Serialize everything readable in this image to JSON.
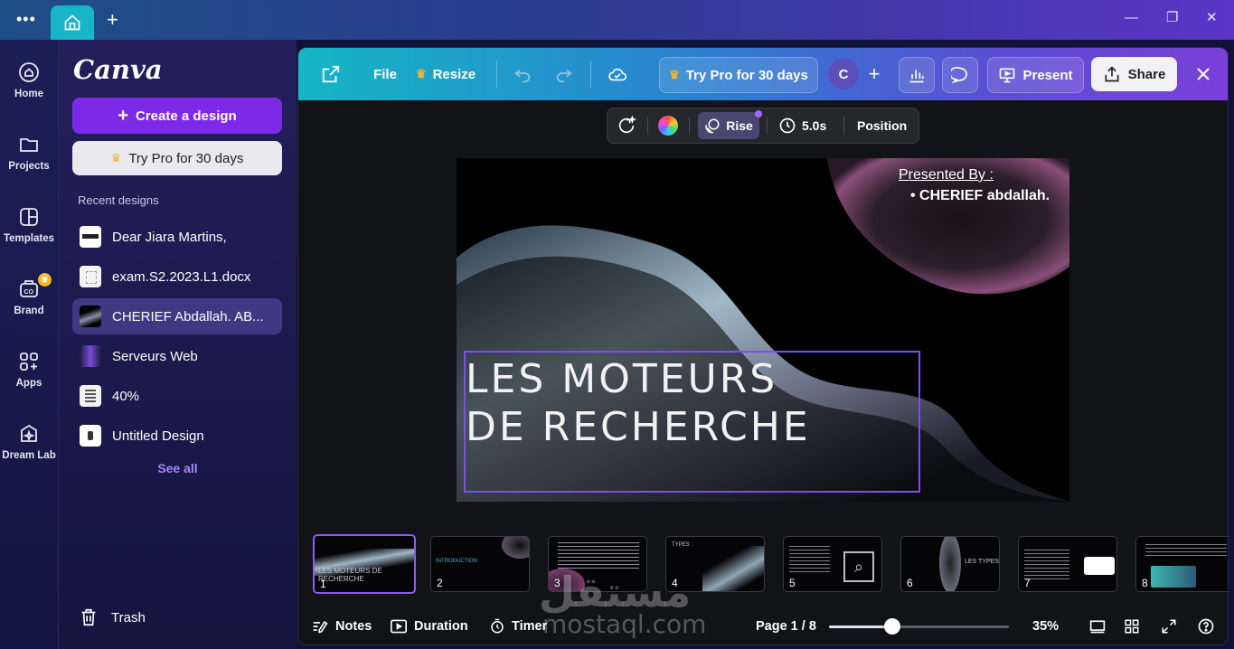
{
  "titlebar": {
    "menu_icon": "more-dots-icon",
    "home_tab_icon": "home-icon",
    "new_tab": "+",
    "minimize": "—",
    "maximize": "❐",
    "close": "✕"
  },
  "rail": {
    "items": [
      {
        "label": "Home",
        "icon": "home-icon"
      },
      {
        "label": "Projects",
        "icon": "folder-icon"
      },
      {
        "label": "Templates",
        "icon": "templates-icon"
      },
      {
        "label": "Brand",
        "icon": "brand-icon"
      },
      {
        "label": "Apps",
        "icon": "apps-icon"
      },
      {
        "label": "Dream Lab",
        "icon": "dream-lab-icon"
      }
    ]
  },
  "sidebar": {
    "logo": "Canva",
    "create_label": "Create a design",
    "pro_label": "Try Pro for 30 days",
    "recent_title": "Recent designs",
    "recent": [
      {
        "name": "Dear Jiara Martins,"
      },
      {
        "name": "exam.S2.2023.L1.docx"
      },
      {
        "name": "CHERIEF Abdallah. AB..."
      },
      {
        "name": "Serveurs Web"
      },
      {
        "name": "40%"
      },
      {
        "name": "Untitled Design"
      }
    ],
    "see_all": "See all",
    "trash": "Trash"
  },
  "toolbar": {
    "file": "File",
    "resize": "Resize",
    "try_pro": "Try Pro for 30 days",
    "avatar_initial": "C",
    "present": "Present",
    "share": "Share"
  },
  "context": {
    "rise": "Rise",
    "duration": "5.0s",
    "position": "Position"
  },
  "slide": {
    "presented_by": "Presented By :",
    "author": "CHERIEF abdallah.",
    "title_line1": "LES MOTEURS",
    "title_line2": "DE RECHERCHE"
  },
  "pages": [
    {
      "num": "1",
      "text": "LES MOTEURS DE RECHERCHE"
    },
    {
      "num": "2",
      "text": "INTRODUCTION"
    },
    {
      "num": "3",
      "text": ""
    },
    {
      "num": "4",
      "text": "TYPES :"
    },
    {
      "num": "5",
      "text": ""
    },
    {
      "num": "6",
      "text": "LES TYPES"
    },
    {
      "num": "7",
      "text": ""
    },
    {
      "num": "8",
      "text": ""
    }
  ],
  "bottom": {
    "notes": "Notes",
    "duration": "Duration",
    "timer": "Timer",
    "page_indicator": "Page 1 / 8",
    "zoom": "35%",
    "zoom_fraction": 0.35
  },
  "watermark": {
    "arabic": "مستقل",
    "latin": "mostaql.com"
  },
  "colors": {
    "accent": "#7d2ae8",
    "selection": "#7d4df0",
    "toolbar_start": "#14b6c4",
    "toolbar_end": "#7a3fd8"
  }
}
